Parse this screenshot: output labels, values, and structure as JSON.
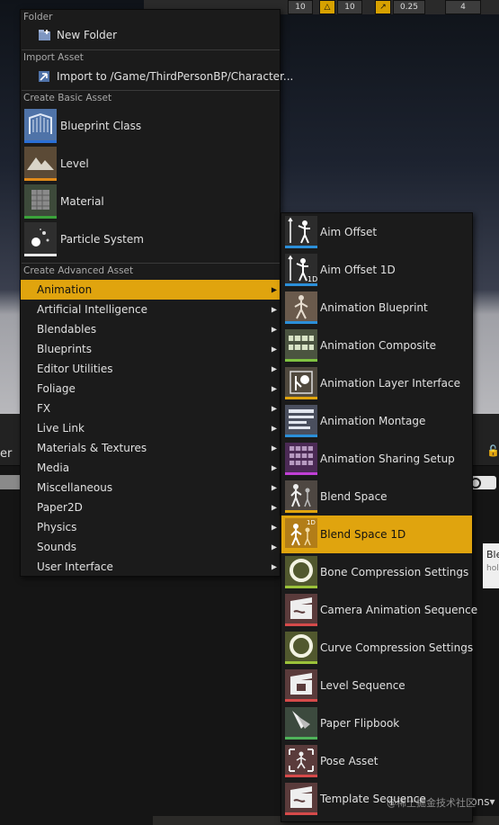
{
  "toolbar": {
    "btn_a": "10",
    "btn_b": "10",
    "btn_c": "0.25",
    "btn_d": "4"
  },
  "background": {
    "panel_title": "er",
    "options_label": "ions▾",
    "tooltip_title": "Ble",
    "tooltip_sub": "hol"
  },
  "menu": {
    "folder_header": "Folder",
    "new_folder": "New Folder",
    "import_header": "Import Asset",
    "import_item": "Import to /Game/ThirdPersonBP/Character...",
    "basic_header": "Create Basic Asset",
    "basic_items": [
      "Blueprint Class",
      "Level",
      "Material",
      "Particle System"
    ],
    "advanced_header": "Create Advanced Asset",
    "advanced_items": [
      "Animation",
      "Artificial Intelligence",
      "Blendables",
      "Blueprints",
      "Editor Utilities",
      "Foliage",
      "FX",
      "Live Link",
      "Materials & Textures",
      "Media",
      "Miscellaneous",
      "Paper2D",
      "Physics",
      "Sounds",
      "User Interface"
    ]
  },
  "submenu": {
    "items": [
      "Aim Offset",
      "Aim Offset 1D",
      "Animation Blueprint",
      "Animation Composite",
      "Animation Layer Interface",
      "Animation Montage",
      "Animation Sharing Setup",
      "Blend Space",
      "Blend Space 1D",
      "Bone Compression Settings",
      "Camera Animation Sequence",
      "Curve Compression Settings",
      "Level Sequence",
      "Paper Flipbook",
      "Pose Asset",
      "Template Sequence"
    ]
  },
  "watermark": "@稀土掘金技术社区",
  "colors": {
    "highlight": "#e0a40e",
    "menu_bg": "#1b1b1b",
    "blueprint_accent": "#2a6fd6",
    "level_accent": "#e08a1a",
    "material_accent": "#3aa33a",
    "particle_accent": "#e8e8e8",
    "animation_accent": "#2b8fd9"
  }
}
